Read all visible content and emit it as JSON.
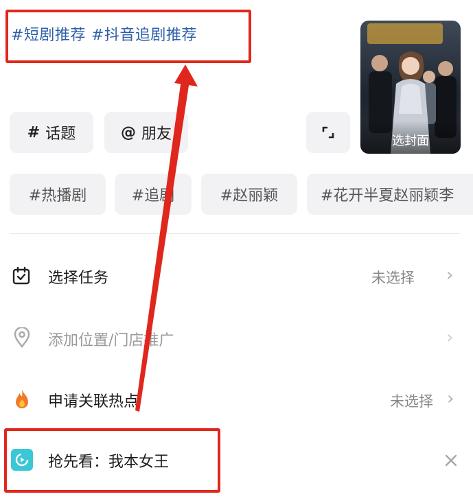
{
  "top": {
    "hashtag1": "#短剧推荐",
    "hashtag2": "#抖音追剧推荐"
  },
  "cover": {
    "label": "选封面"
  },
  "chips": {
    "topic": {
      "symbol": "#",
      "label": "话题"
    },
    "friend": {
      "symbol": "@",
      "label": "朋友"
    }
  },
  "tags": [
    "#热播剧",
    "#追剧",
    "#赵丽颖",
    "#花开半夏赵丽颖李"
  ],
  "rows": {
    "task": {
      "label": "选择任务",
      "value": "未选择"
    },
    "location": {
      "label": "添加位置/门店推广"
    },
    "hotspot": {
      "label": "申请关联热点",
      "value": "未选择"
    },
    "preview": {
      "label": "抢先看：我本女王"
    }
  },
  "colors": {
    "hashtag_text": "#2e5fa8",
    "highlight_red": "#e0271d",
    "chip_bg": "#f2f2f4",
    "preview_icon_bg": "#3cc7d6",
    "flame": "#f07a2a"
  },
  "icons": {
    "crop": "crop-icon",
    "task": "calendar-check-icon",
    "location": "location-pin-icon",
    "hotspot": "flame-icon",
    "preview": "preview-play-icon",
    "close": "close-icon",
    "chevron": "chevron-right-icon"
  }
}
